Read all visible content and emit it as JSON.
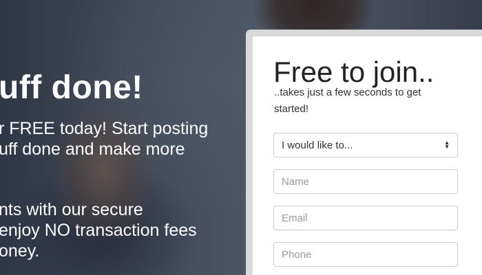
{
  "hero": {
    "headline": "uff done!",
    "paragraph1": [
      "r FREE today! Start posting",
      "uff done and make more"
    ],
    "paragraph2": [
      "nts with our secure",
      " enjoy NO transaction fees",
      "oney."
    ]
  },
  "signup": {
    "title": "Free to join..",
    "subtitle": "..takes just a few seconds to get started!",
    "role_select": {
      "selected": "I would like to...",
      "icon": "chevron-updown-icon"
    },
    "name_placeholder": "Name",
    "email_placeholder": "Email",
    "phone_placeholder": "Phone"
  },
  "colors": {
    "panel_border": "#d9d9d9",
    "heading_text": "#222222",
    "placeholder_text": "#999999"
  }
}
